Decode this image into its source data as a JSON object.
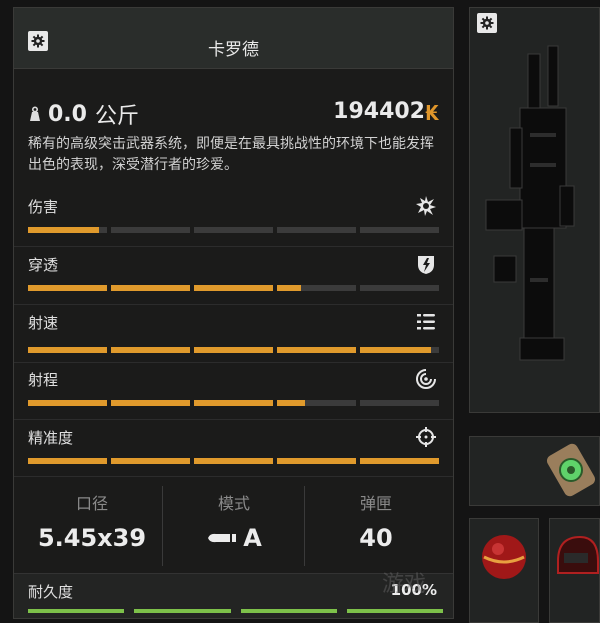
{
  "item": {
    "name": "卡罗德",
    "weight": "0.0",
    "weight_unit": "公斤",
    "price": "194402",
    "currency_icon": "₭",
    "description": "稀有的高级突击武器系统，即便是在最具挑战性的环境下也能发挥出色的表现，深受潜行者的珍爱。"
  },
  "stats": [
    {
      "label": "伤害",
      "icon": "explosion-icon",
      "level": 0.18
    },
    {
      "label": "穿透",
      "icon": "armor-pierce-icon",
      "level": 0.66
    },
    {
      "label": "射速",
      "icon": "rate-of-fire-icon",
      "level": 0.98
    },
    {
      "label": "射程",
      "icon": "range-icon",
      "level": 0.67
    },
    {
      "label": "精准度",
      "icon": "crosshair-icon",
      "level": 1.0
    }
  ],
  "specs": [
    {
      "header": "口径",
      "value": "5.45x39"
    },
    {
      "header": "模式",
      "value": "A"
    },
    {
      "header": "弹匣",
      "value": "40"
    }
  ],
  "durability": {
    "label": "耐久度",
    "value": "100%",
    "level": 1.0
  },
  "colors": {
    "accent": "#e09a2c",
    "durability": "#7dc14a",
    "bar_bg": "#3b3b3b"
  },
  "watermark": "游戏"
}
